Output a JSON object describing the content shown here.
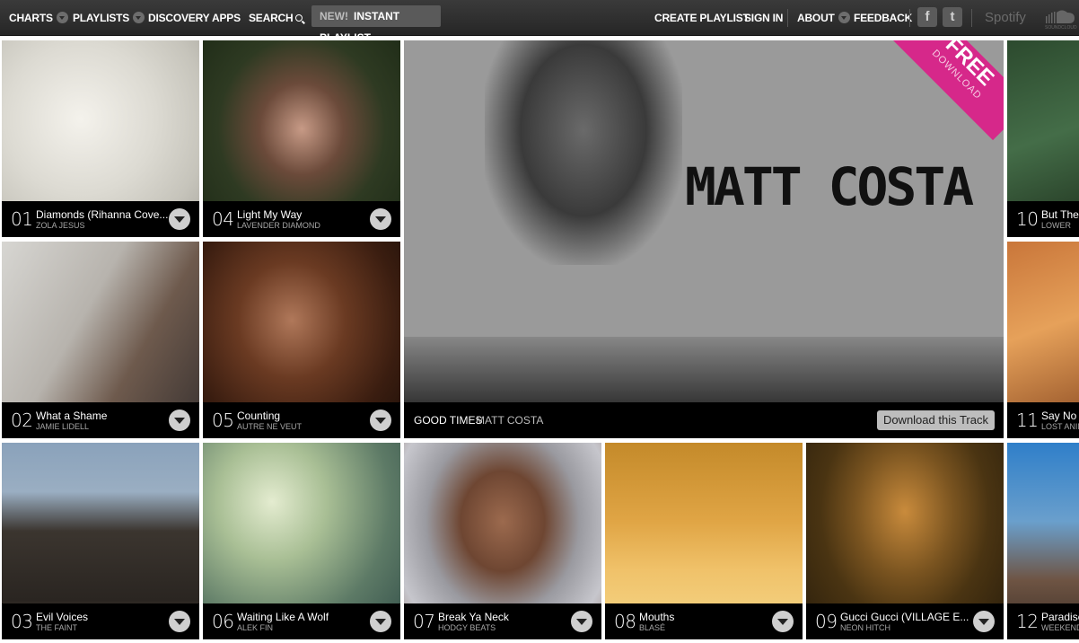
{
  "nav": {
    "charts": "CHARTS",
    "playlists": "PLAYLISTS",
    "discovery": "DISCOVERY",
    "apps": "APPS",
    "search": "SEARCH",
    "instant_badge": "NEW!",
    "instant_label": "INSTANT PLAYLIST",
    "create_playlist": "CREATE PLAYLIST",
    "sign_in": "SIGN IN",
    "about": "ABOUT",
    "feedback": "FEEDBACK",
    "facebook": "f",
    "twitter": "t",
    "spotify": "Spotify",
    "soundcloud": "SOUNDCLOUD"
  },
  "featured": {
    "name": "MATT COSTA",
    "song": "GOOD TIMES",
    "artist": "MATT COSTA",
    "download_label": "Download this Track",
    "ribbon_free": "FREE",
    "ribbon_download": "DOWNLOAD",
    "ribbon_color": "#d6288a"
  },
  "tracks": [
    {
      "num": "01",
      "title": "Diamonds (Rihanna Cove...",
      "artist": "ZOLA JESUS"
    },
    {
      "num": "02",
      "title": "What a Shame",
      "artist": "JAMIE LIDELL"
    },
    {
      "num": "03",
      "title": "Evil Voices",
      "artist": "THE FAINT"
    },
    {
      "num": "04",
      "title": "Light My Way",
      "artist": "LAVENDER DIAMOND"
    },
    {
      "num": "05",
      "title": "Counting",
      "artist": "AUTRE NE VEUT"
    },
    {
      "num": "06",
      "title": "Waiting Like A Wolf",
      "artist": "ALEK FIN"
    },
    {
      "num": "07",
      "title": "Break Ya Neck",
      "artist": "HODGY BEATS"
    },
    {
      "num": "08",
      "title": "Mouths",
      "artist": "BLASÉ"
    },
    {
      "num": "09",
      "title": "Gucci Gucci (VILLAGE E...",
      "artist": "NEON HITCH"
    },
    {
      "num": "10",
      "title": "But Ther",
      "artist": "LOWER"
    },
    {
      "num": "11",
      "title": "Say No T",
      "artist": "LOST ANIM"
    },
    {
      "num": "12",
      "title": "Paradise",
      "artist": "WEEKEND"
    }
  ]
}
